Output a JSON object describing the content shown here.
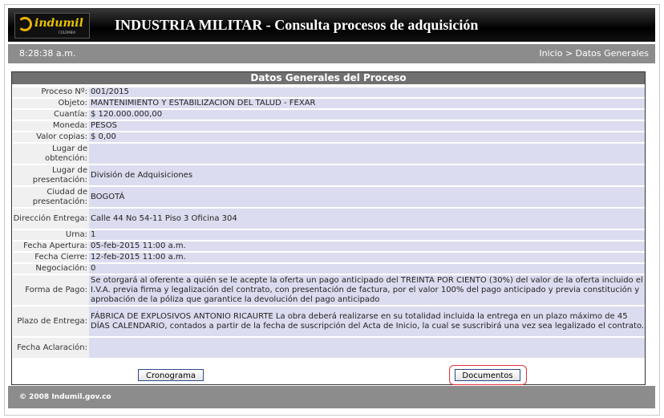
{
  "header": {
    "logo_text": "indumil",
    "logo_sub": "COLOMBIA",
    "title": "INDUSTRIA MILITAR - Consulta procesos de adquisición"
  },
  "infobar": {
    "time": "8:28:38 a.m.",
    "breadcrumb_home": "Inicio",
    "breadcrumb_sep": ">",
    "breadcrumb_current": "Datos Generales"
  },
  "panel": {
    "title": "Datos Generales del Proceso",
    "rows": [
      {
        "label": "Proceso Nº:",
        "value": "001/2015"
      },
      {
        "label": "Objeto:",
        "value": "MANTENIMIENTO Y ESTABILIZACION DEL TALUD - FEXAR"
      },
      {
        "label": "Cuantía:",
        "value": "$ 120.000.000,00"
      },
      {
        "label": "Moneda:",
        "value": "PESOS"
      },
      {
        "label": "Valor copias:",
        "value": "$ 0,00"
      },
      {
        "label": "Lugar de obtención:",
        "value": ""
      },
      {
        "label": "Lugar de presentación:",
        "value": "División de Adquisiciones"
      },
      {
        "label": "Ciudad de presentación:",
        "value": "BOGOTÁ"
      },
      {
        "label": "Dirección Entrega:",
        "value": "Calle 44 No 54-11 Piso 3 Oficina 304"
      },
      {
        "label": "Urna:",
        "value": "1"
      },
      {
        "label": "Fecha Apertura:",
        "value": "05-feb-2015 11:00 a.m."
      },
      {
        "label": "Fecha Cierre:",
        "value": "12-feb-2015 11:00 a.m."
      },
      {
        "label": "Negociación:",
        "value": "0"
      },
      {
        "label": "Forma de Pago:",
        "value": "Se otorgará al oferente a quién se le acepte la oferta un pago anticipado del TREINTA POR CIENTO (30%) del valor de la oferta incluido el I.V.A. previa firma y legalización del contrato, con presentación de factura, por el valor 100% del pago anticipado y previa constitución y aprobación de la póliza que garantice la devolución del pago anticipado"
      },
      {
        "label": "Plazo de Entrega:",
        "value": "FÁBRICA DE EXPLOSIVOS ANTONIO RICAURTE La obra deberá realizarse en su totalidad incluida la entrega en un plazo máximo de 45 DÍAS CALENDARIO, contados a partir de la fecha de suscripción del Acta de Inicio, la cual se suscribirá una vez sea legalizado el contrato."
      },
      {
        "label": "Fecha Aclaración:",
        "value": ""
      }
    ],
    "buttons": {
      "cronograma": "Cronograma",
      "documentos": "Documentos"
    }
  },
  "footer": {
    "copyright": "© 2008 Indumil.gov.co"
  },
  "colors": {
    "header_bg": "#000000",
    "bar_bg": "#8c8c8c",
    "value_bg": "#dcdcf0",
    "label_bg": "#f0f0f0",
    "highlight": "#e0303a"
  }
}
